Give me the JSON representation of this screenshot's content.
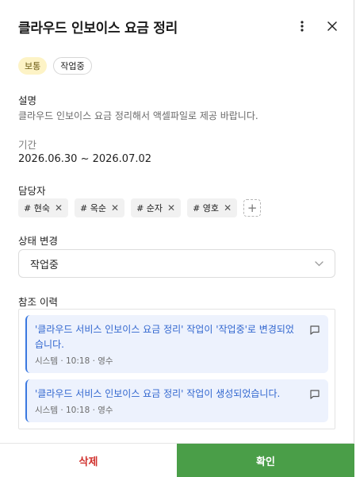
{
  "header": {
    "title": "클라우드 인보이스 요금 정리",
    "more_icon": "kebab-vertical-icon",
    "close_icon": "close-icon"
  },
  "tags": {
    "priority": "보통",
    "status": "작업중"
  },
  "description": {
    "label": "설명",
    "text": "클라우드 인보이스 요금 정리해서 액셀파일로 제공 바랍니다."
  },
  "period": {
    "label": "기간",
    "value": "2026.06.30 ~ 2026.07.02"
  },
  "assignees": {
    "label": "담당자",
    "items": [
      "# 현숙",
      "# 옥순",
      "# 순자",
      "# 영호"
    ],
    "remove_symbol": "✕",
    "add_symbol": "+"
  },
  "status_change": {
    "label": "상태 변경",
    "selected": "작업중"
  },
  "history": {
    "label": "참조 이력",
    "entries": [
      {
        "text": "'클라우드 서비스 인보이스 요금 정리' 작업이 '작업중'로 변경되었습니다.",
        "meta": "시스템 · 10:18 · 영수"
      },
      {
        "text": "'클라우드 서비스 인보이스 요금 정리' 작업이 생성되었습니다.",
        "meta": "시스템 · 10:18 · 영수"
      }
    ]
  },
  "footer": {
    "delete_label": "삭제",
    "confirm_label": "확인"
  },
  "colors": {
    "confirm_bg": "#4a9e48",
    "delete_text": "#d0312d",
    "history_text": "#3166cf",
    "history_bg": "#edf2fd",
    "priority_bg": "#fdf3c6"
  }
}
